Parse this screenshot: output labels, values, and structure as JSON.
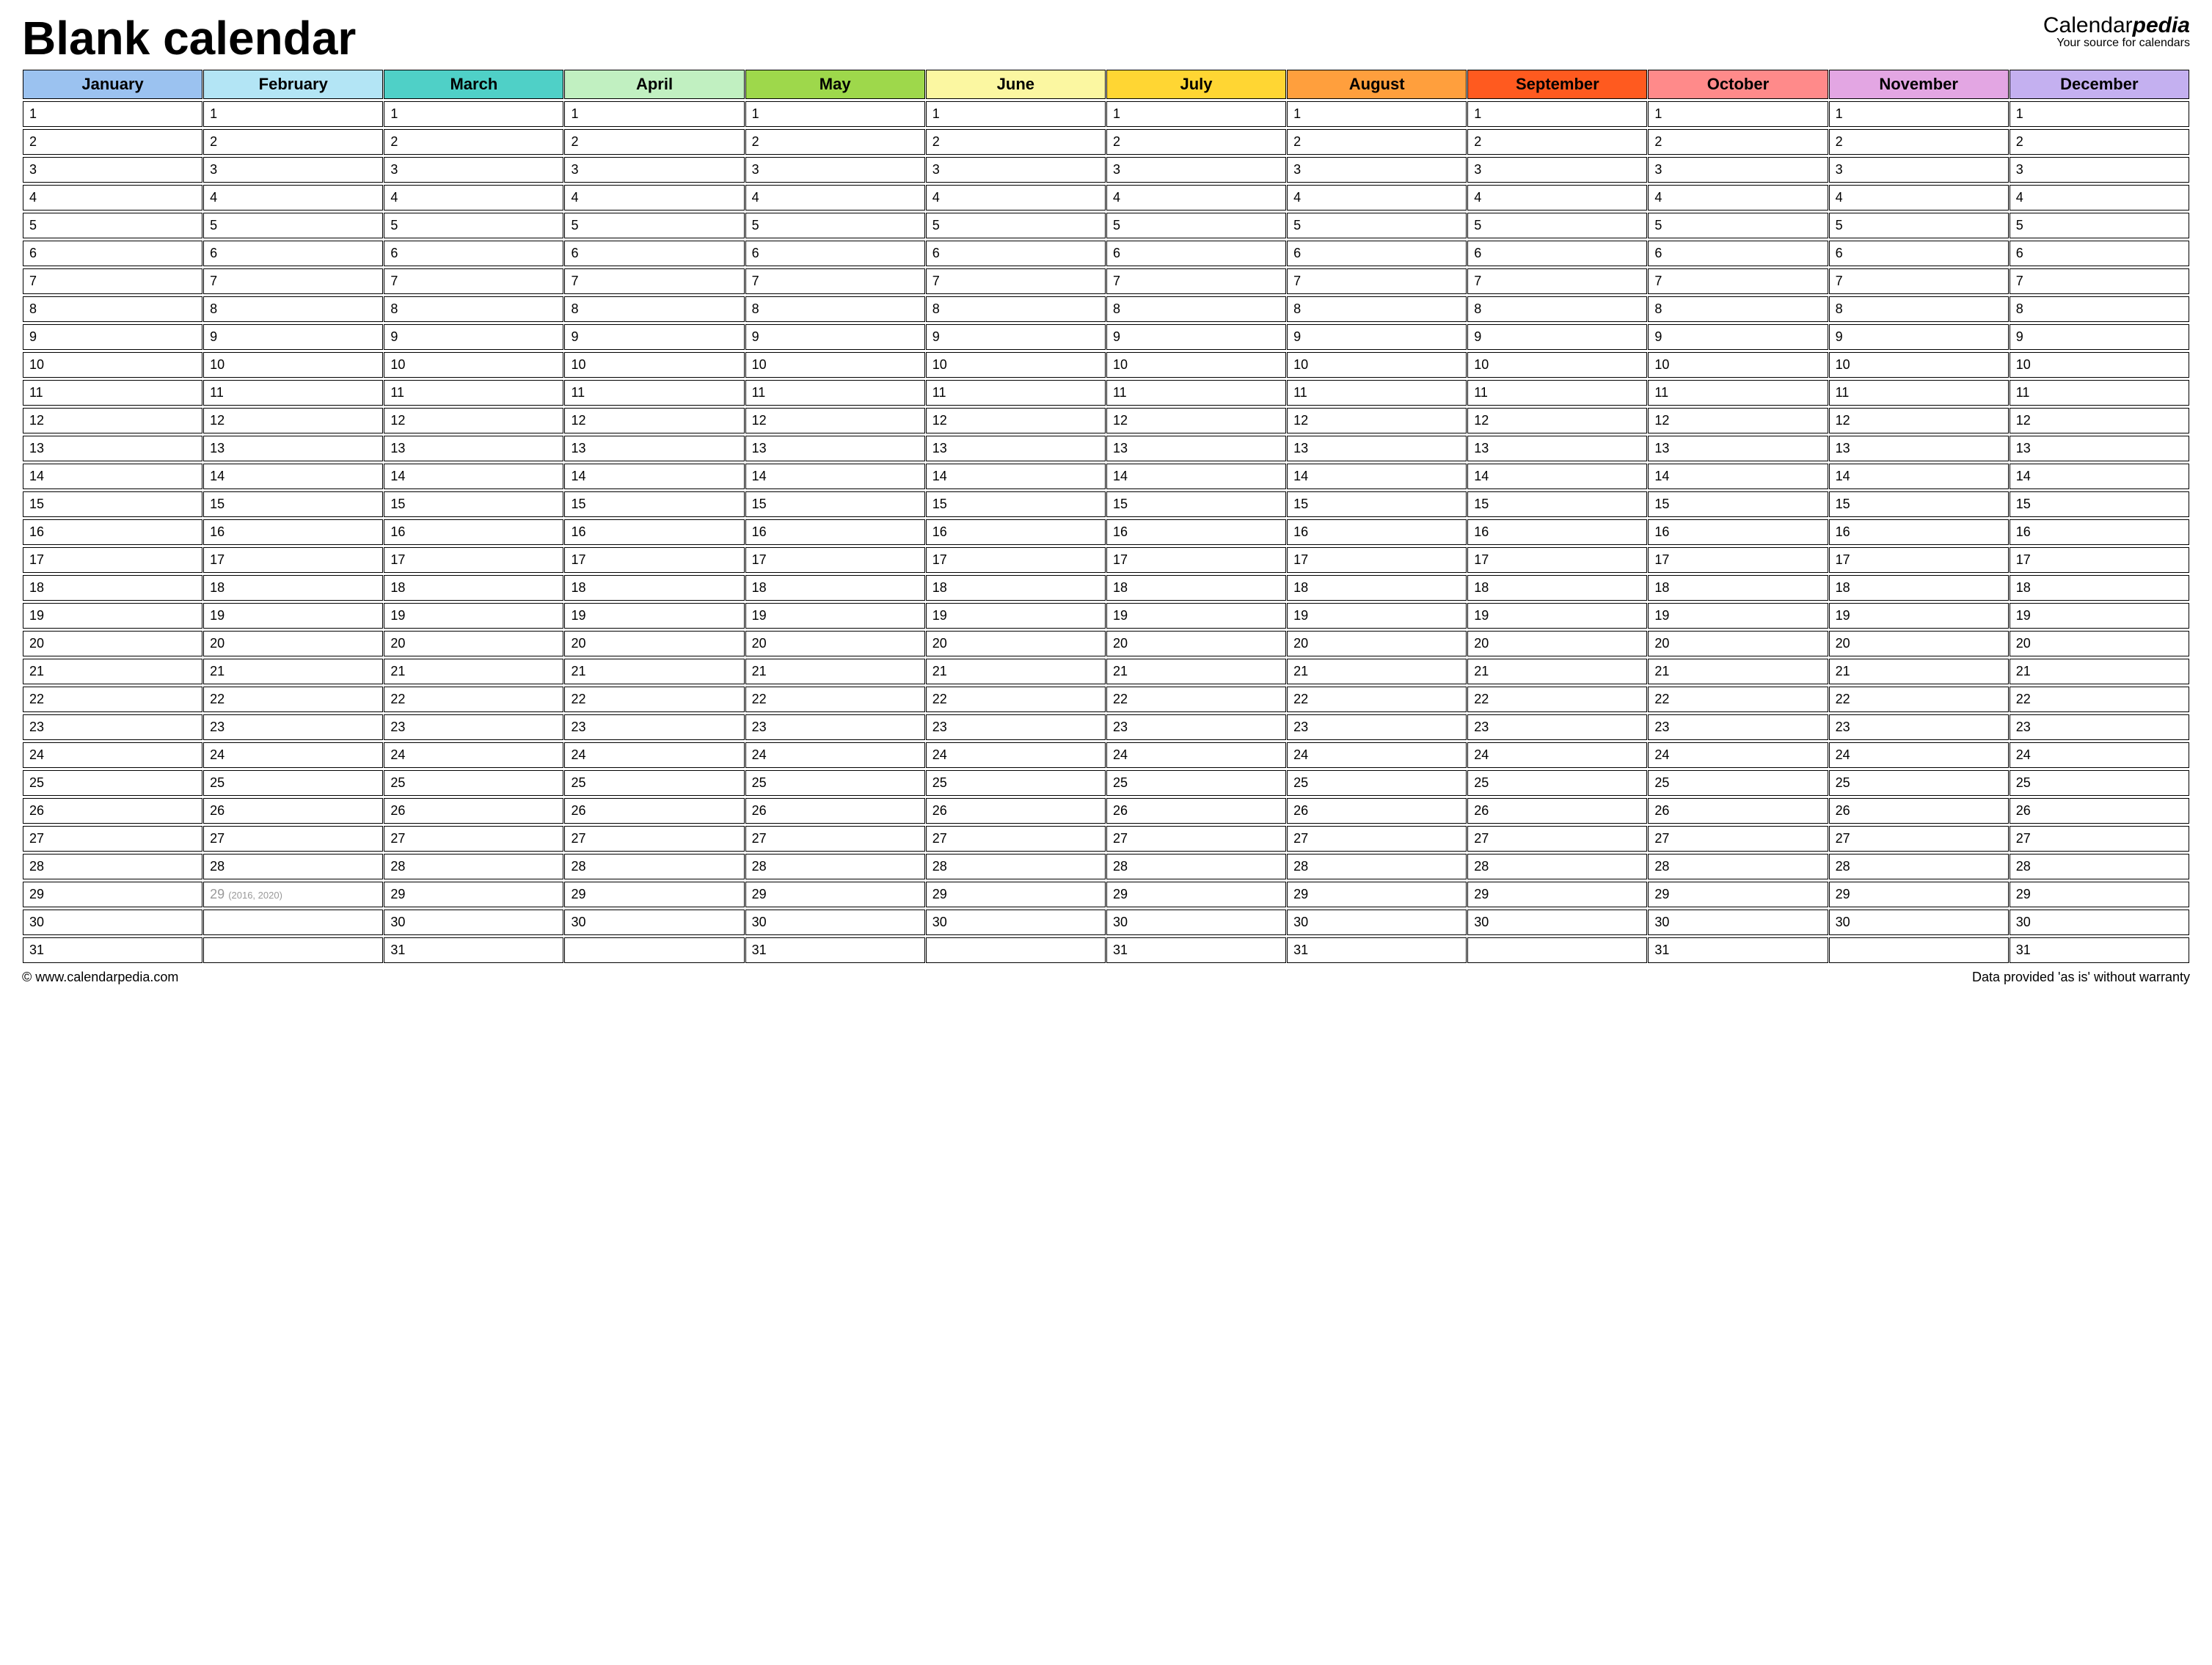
{
  "title": "Blank calendar",
  "brand": {
    "part1": "Calendar",
    "part2": "pedia",
    "tagline": "Your source for calendars"
  },
  "months": [
    {
      "name": "January",
      "color": "#9bc2f0",
      "days": 31
    },
    {
      "name": "February",
      "color": "#b3e5f5",
      "days": 28
    },
    {
      "name": "March",
      "color": "#4fd0c7",
      "days": 31
    },
    {
      "name": "April",
      "color": "#c1f0c1",
      "days": 30
    },
    {
      "name": "May",
      "color": "#9ed84b",
      "days": 31
    },
    {
      "name": "June",
      "color": "#fbf7a1",
      "days": 30
    },
    {
      "name": "July",
      "color": "#ffd633",
      "days": 31
    },
    {
      "name": "August",
      "color": "#ff9f3d",
      "days": 31
    },
    {
      "name": "September",
      "color": "#ff5a1f",
      "days": 30
    },
    {
      "name": "October",
      "color": "#ff8a8a",
      "days": 31
    },
    {
      "name": "November",
      "color": "#e3a6e3",
      "days": 30
    },
    {
      "name": "December",
      "color": "#c4b0f0",
      "days": 31
    }
  ],
  "leap_cell": {
    "month_index": 1,
    "day": 29,
    "note": "(2016, 2020)"
  },
  "max_rows": 31,
  "footer": {
    "left": "© www.calendarpedia.com",
    "right": "Data provided 'as is' without warranty"
  }
}
